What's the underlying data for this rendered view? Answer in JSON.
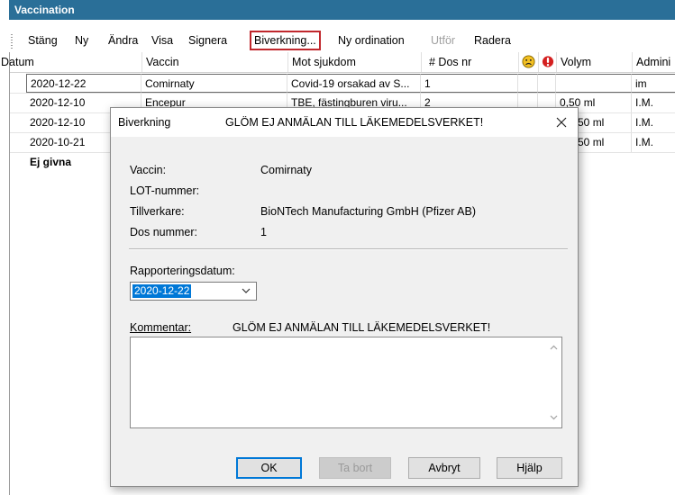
{
  "window": {
    "title": "Vaccination"
  },
  "toolbar": {
    "items": [
      {
        "label": "Stäng",
        "enabled": true
      },
      {
        "label": "Ny",
        "enabled": true
      },
      {
        "label": "Ändra",
        "enabled": true
      },
      {
        "label": "Visa",
        "enabled": true
      },
      {
        "label": "Signera",
        "enabled": true
      },
      {
        "label": "Biverkning...",
        "enabled": true,
        "highlighted": true
      },
      {
        "label": "Ny ordination",
        "enabled": true
      },
      {
        "label": "Utför",
        "enabled": false
      },
      {
        "label": "Radera",
        "enabled": true
      }
    ]
  },
  "grid": {
    "columns": [
      "Datum",
      "Vaccin",
      "Mot sjukdom",
      "# Dos nr",
      "",
      "",
      "Volym",
      "Admini"
    ],
    "column_icons": [
      "sad-face-icon",
      "alert-icon"
    ],
    "rows": [
      {
        "datum": "2020-12-22",
        "vaccin": "Comirnaty",
        "mot": "Covid-19 orsakad av S...",
        "dos": "1",
        "volym": "",
        "admin": "im"
      },
      {
        "datum": "2020-12-10",
        "vaccin": "Encepur",
        "mot": "TBE, fästingburen viru...",
        "dos": "2",
        "volym": "0,50 ml",
        "admin": "I.M."
      },
      {
        "datum": "2020-12-10",
        "vaccin": "",
        "mot": "",
        "dos": "",
        "volym": "0,50 ml",
        "admin": "I.M."
      },
      {
        "datum": "2020-10-21",
        "vaccin": "",
        "mot": "",
        "dos": "",
        "volym": "0,50 ml",
        "admin": "I.M."
      }
    ],
    "group_label": "Ej givna"
  },
  "dialog": {
    "title": "Biverkning",
    "title_message": "GLÖM EJ ANMÄLAN TILL LÄKEMEDELSVERKET!",
    "fields": {
      "vaccin_label": "Vaccin:",
      "vaccin_value": "Comirnaty",
      "lot_label": "LOT-nummer:",
      "lot_value": "",
      "tillverkare_label": "Tillverkare:",
      "tillverkare_value": "BioNTech Manufacturing GmbH (Pfizer AB)",
      "dos_label": "Dos nummer:",
      "dos_value": "1"
    },
    "rapportering_label": "Rapporteringsdatum:",
    "rapportering_value": "2020-12-22",
    "kommentar_label": "Kommentar:",
    "kommentar_message": "GLÖM EJ ANMÄLAN TILL LÄKEMEDELSVERKET!",
    "kommentar_value": "",
    "buttons": {
      "ok": "OK",
      "ta_bort": "Ta bort",
      "avbryt": "Avbryt",
      "hjalp": "Hjälp"
    }
  },
  "colors": {
    "titlebar": "#2a6f98",
    "highlight_border": "#c0282d",
    "selection": "#0078d7"
  }
}
